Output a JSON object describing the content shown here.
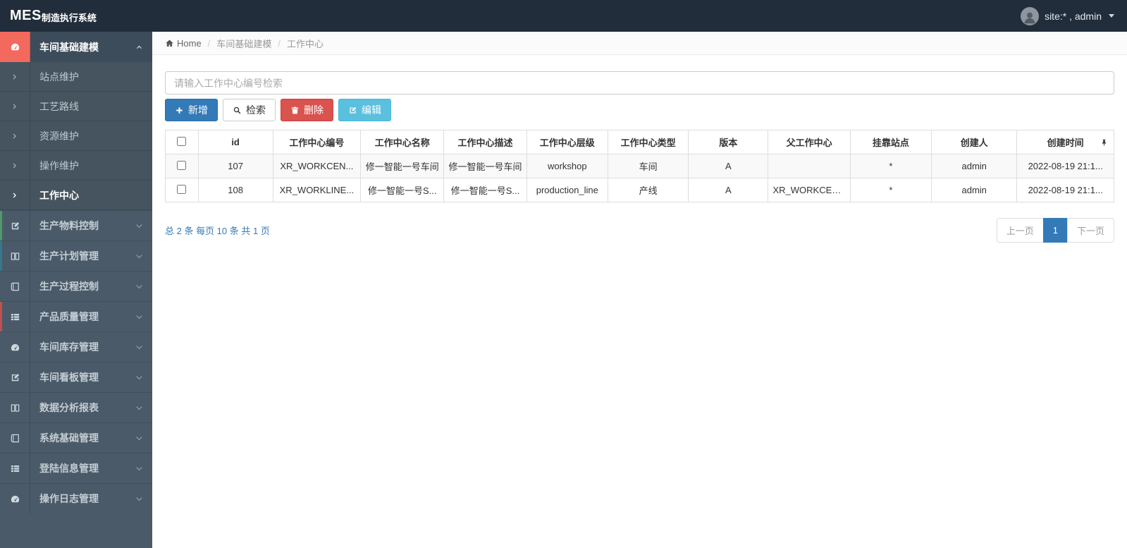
{
  "navbar": {
    "logo_bold": "MES",
    "logo_rest": "制造执行系统",
    "user_label": "site:* , admin"
  },
  "breadcrumb": {
    "home": "Home",
    "separator": "/",
    "level1": "车间基础建模",
    "level2": "工作中心"
  },
  "sidebar": {
    "section": {
      "label": "车间基础建模",
      "icon": "dashboard-icon",
      "icon_bg": "#f4695e"
    },
    "submenu": [
      {
        "label": "站点维护"
      },
      {
        "label": "工艺路线"
      },
      {
        "label": "资源维护"
      },
      {
        "label": "操作维护"
      },
      {
        "label": "工作中心",
        "active": true
      }
    ],
    "items": [
      {
        "label": "生产物料控制",
        "icon": "edit-icon",
        "strip": "#c9a53f"
      },
      {
        "label": "生产计划管理",
        "icon": "columns-icon",
        "strip": "#4e9a68"
      },
      {
        "label": "生产过程控制",
        "icon": "book-icon",
        "strip": "#33788c"
      },
      {
        "label": "产品质量管理",
        "icon": "list-icon",
        "strip": ""
      },
      {
        "label": "车间库存管理",
        "icon": "dashboard-icon",
        "strip": "#c05050"
      },
      {
        "label": "车间看板管理",
        "icon": "edit-icon",
        "strip": "#c9a53f"
      },
      {
        "label": "数据分析报表",
        "icon": "columns-icon",
        "strip": "#4e9a68"
      },
      {
        "label": "系统基础管理",
        "icon": "book-icon",
        "strip": "#33788c"
      },
      {
        "label": "登陆信息管理",
        "icon": "list-icon",
        "strip": ""
      },
      {
        "label": "操作日志管理",
        "icon": "dashboard-icon",
        "strip": "#c05050"
      }
    ]
  },
  "search": {
    "placeholder": "请输入工作中心编号检索",
    "value": ""
  },
  "toolbar": {
    "add_label": "新增",
    "search_label": "检索",
    "delete_label": "删除",
    "edit_label": "编辑"
  },
  "table": {
    "headers": [
      "id",
      "工作中心编号",
      "工作中心名称",
      "工作中心描述",
      "工作中心层级",
      "工作中心类型",
      "版本",
      "父工作中心",
      "挂靠站点",
      "创建人",
      "创建时间"
    ],
    "rows": [
      {
        "cells": [
          "107",
          "XR_WORKCEN...",
          "修一智能一号车间",
          "修一智能一号车间",
          "workshop",
          "车间",
          "A",
          "",
          "*",
          "admin",
          "2022-08-19 21:1..."
        ]
      },
      {
        "cells": [
          "108",
          "XR_WORKLINE...",
          "修一智能一号S...",
          "修一智能一号S...",
          "production_line",
          "产线",
          "A",
          "XR_WORKCEN...",
          "*",
          "admin",
          "2022-08-19 21:1..."
        ]
      }
    ]
  },
  "pagination": {
    "summary": "总 2 条 每页 10 条 共 1 页",
    "prev_label": "上一页",
    "current_page": "1",
    "next_label": "下一页"
  },
  "colors": {
    "primary": "#337ab7",
    "danger": "#d9534f",
    "info": "#5bc0de",
    "navbar_bg": "#222d3b",
    "sidebar_bg": "#4b5a68",
    "active_icon_bg": "#f4695e"
  }
}
